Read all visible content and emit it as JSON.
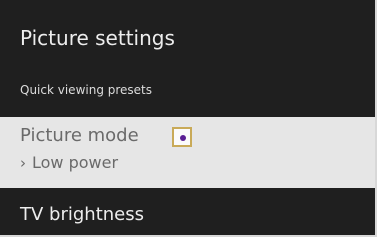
{
  "screen": {
    "title": "Picture settings",
    "section_label": "Quick viewing presets"
  },
  "picture_mode": {
    "label": "Picture mode",
    "value_prefix": "›",
    "value": "Low power",
    "star_icon": "options-star-icon",
    "accent_color": "#5a1e94",
    "focus_border_color": "#c9aa58"
  },
  "next_item": {
    "label": "TV brightness"
  }
}
